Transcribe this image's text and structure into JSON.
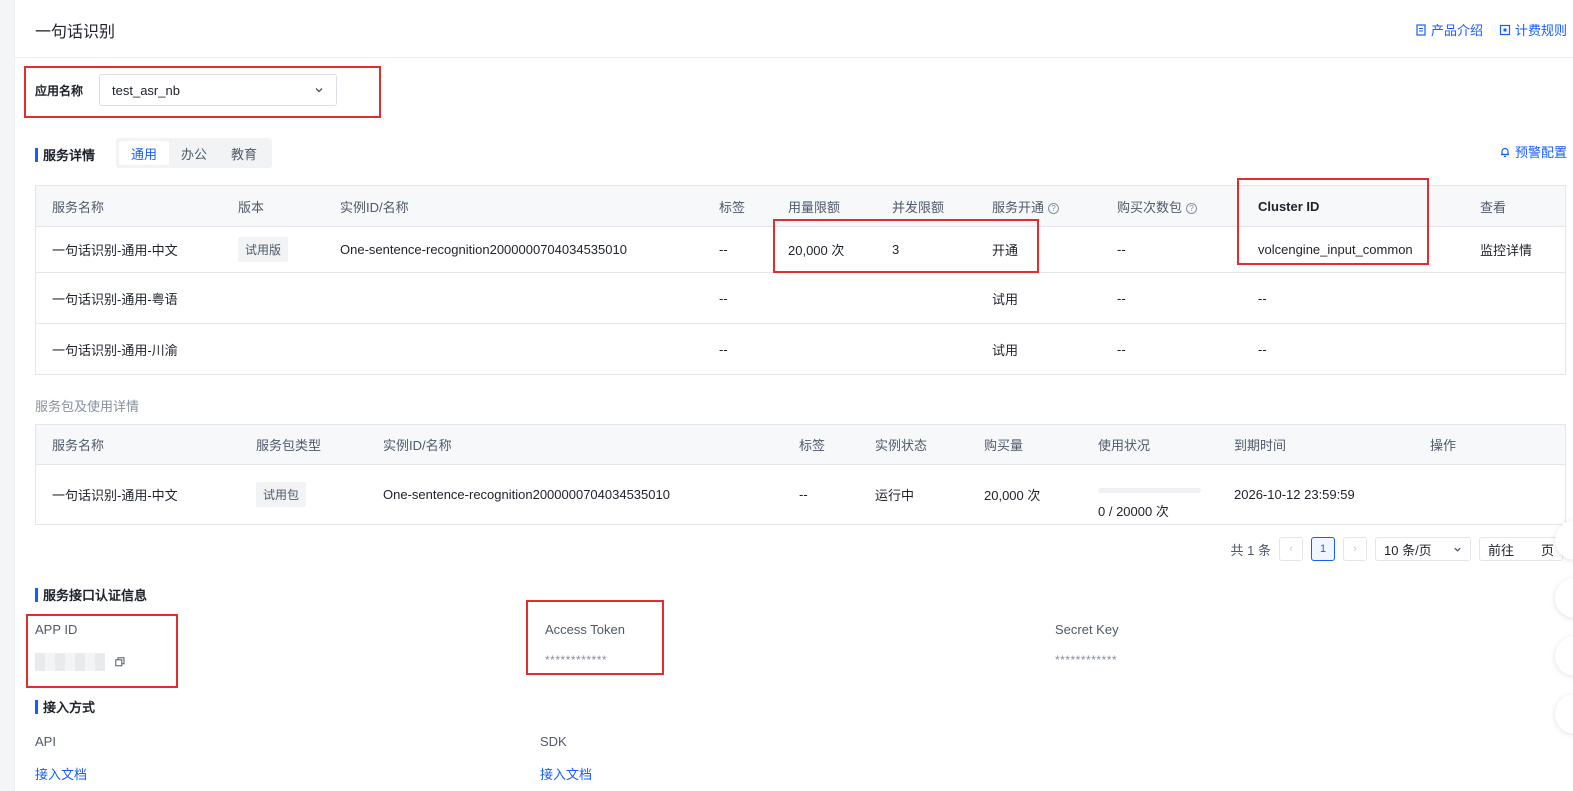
{
  "header": {
    "title": "一句话识别",
    "links": [
      {
        "label": "产品介绍",
        "icon": "document-icon"
      },
      {
        "label": "计费规则",
        "icon": "billing-icon"
      }
    ]
  },
  "app_selector": {
    "label": "应用名称",
    "value": "test_asr_nb"
  },
  "service_detail": {
    "title": "服务详情",
    "tabs": [
      {
        "label": "通用",
        "active": true
      },
      {
        "label": "办公",
        "active": false
      },
      {
        "label": "教育",
        "active": false
      }
    ],
    "alarm_label": "预警配置",
    "columns": [
      "服务名称",
      "版本",
      "实例ID/名称",
      "标签",
      "用量限额",
      "并发限额",
      "服务开通",
      "购买次数包",
      "Cluster ID",
      "查看"
    ],
    "rows": [
      {
        "name": "一句话识别-通用-中文",
        "version": "试用版",
        "instance": "One-sentence-recognition2000000704034535010",
        "tag": "--",
        "quota": "20,000 次",
        "concurrency": "3",
        "activate": "开通",
        "package": "--",
        "cluster": "volcengine_input_common",
        "view": "监控详情"
      },
      {
        "name": "一句话识别-通用-粤语",
        "version": "",
        "instance": "",
        "tag": "--",
        "quota": "",
        "concurrency": "",
        "activate": "试用",
        "package": "--",
        "cluster": "--",
        "view": ""
      },
      {
        "name": "一句话识别-通用-川渝",
        "version": "",
        "instance": "",
        "tag": "--",
        "quota": "",
        "concurrency": "",
        "activate": "试用",
        "package": "--",
        "cluster": "--",
        "view": ""
      }
    ]
  },
  "packages": {
    "title": "服务包及使用详情",
    "columns": [
      "服务名称",
      "服务包类型",
      "实例ID/名称",
      "标签",
      "实例状态",
      "购买量",
      "使用状况",
      "到期时间",
      "操作"
    ],
    "rows": [
      {
        "name": "一句话识别-通用-中文",
        "type": "试用包",
        "instance": "One-sentence-recognition2000000704034535010",
        "tag": "--",
        "status": "运行中",
        "amount": "20,000 次",
        "usage": "0 / 20000 次",
        "usage_fraction": 0,
        "expire": "2026-10-12 23:59:59",
        "op": ""
      }
    ]
  },
  "pagination": {
    "total": "共 1 条",
    "current": "1",
    "page_size": "10 条/页",
    "jump_prefix": "前往",
    "jump_suffix": "页"
  },
  "auth": {
    "title": "服务接口认证信息",
    "app_id_label": "APP ID",
    "access_token_label": "Access Token",
    "access_token_value": "************",
    "secret_key_label": "Secret Key",
    "secret_key_value": "************"
  },
  "access": {
    "title": "接入方式",
    "api_label": "API",
    "api_link": "接入文档",
    "sdk_label": "SDK",
    "sdk_link": "接入文档"
  },
  "colors": {
    "accent": "#165dff",
    "highlight_box": "#e02d2d"
  }
}
